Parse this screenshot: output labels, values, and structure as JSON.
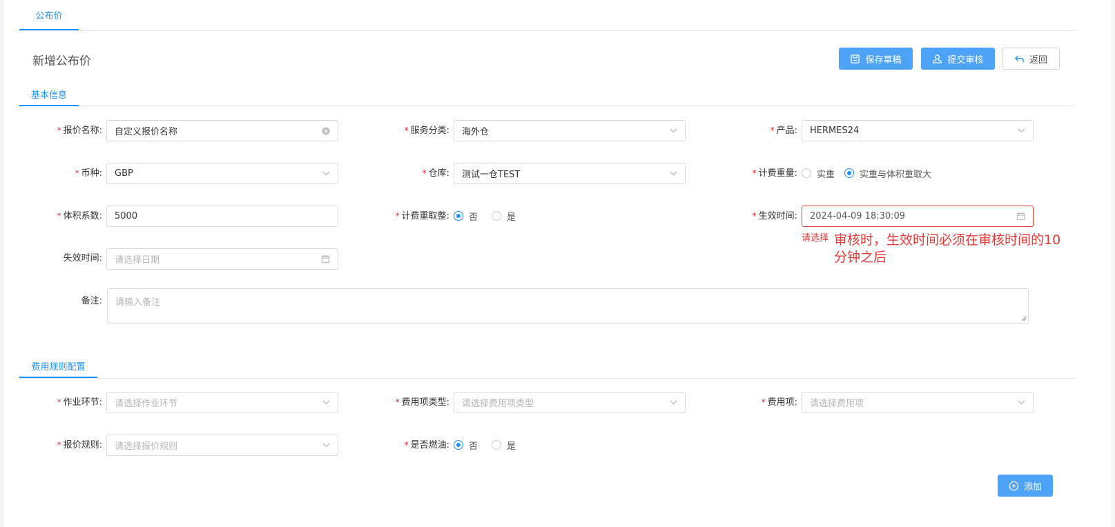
{
  "tabs": [
    {
      "label": "公布价",
      "active": true
    }
  ],
  "page": {
    "title": "新增公布价"
  },
  "toolbar": {
    "save_draft": "保存草稿",
    "submit_review": "提交审核",
    "back": "返回"
  },
  "sections": {
    "basic": "基本信息",
    "fee_rules": "费用规则配置"
  },
  "basic": {
    "quote_name": {
      "label": "报价名称:",
      "required": true,
      "placeholder": "自定义报价名称"
    },
    "service_category": {
      "label": "服务分类:",
      "required": true,
      "value": "海外仓"
    },
    "product": {
      "label": "产品:",
      "required": true,
      "value": "HERMES24"
    },
    "currency": {
      "label": "币种:",
      "required": true,
      "value": "GBP"
    },
    "warehouse": {
      "label": "仓库:",
      "required": true,
      "value": "测试一仓TEST"
    },
    "billing_weight": {
      "label": "计费重量:",
      "required": true,
      "options": [
        "实重",
        "实重与体积重取大"
      ],
      "selected": "实重与体积重取大"
    },
    "volume_factor": {
      "label": "体积系数:",
      "required": true,
      "value": "5000"
    },
    "round_billing_weight": {
      "label": "计费重取整:",
      "required": true,
      "options": [
        "否",
        "是"
      ],
      "selected": "否"
    },
    "effective_time": {
      "label": "生效时间:",
      "required": true,
      "value": "2024-04-09 18:30:09",
      "error": "请选择"
    },
    "expire_time": {
      "label": "失效时间:",
      "required": false,
      "placeholder": "请选择日期"
    },
    "remark": {
      "label": "备注:",
      "required": false,
      "placeholder": "请输入备注"
    }
  },
  "annotation": "审核时，生效时间必须在审核时间的10分钟之后",
  "fee": {
    "operation_step": {
      "label": "作业环节:",
      "required": true,
      "placeholder": "请选择作业环节"
    },
    "fee_item_type": {
      "label": "费用项类型:",
      "required": true,
      "placeholder": "请选择费用项类型"
    },
    "fee_item": {
      "label": "费用项:",
      "required": true,
      "placeholder": "请选择费用项"
    },
    "quote_rule": {
      "label": "报价规则:",
      "required": true,
      "placeholder": "请选择报价规则"
    },
    "fuel": {
      "label": "是否燃油:",
      "required": true,
      "options": [
        "否",
        "是"
      ],
      "selected": "否"
    },
    "add_button": "添加"
  },
  "colors": {
    "primary": "#4ca3f7",
    "link": "#1890ff",
    "error": "#e53935"
  }
}
